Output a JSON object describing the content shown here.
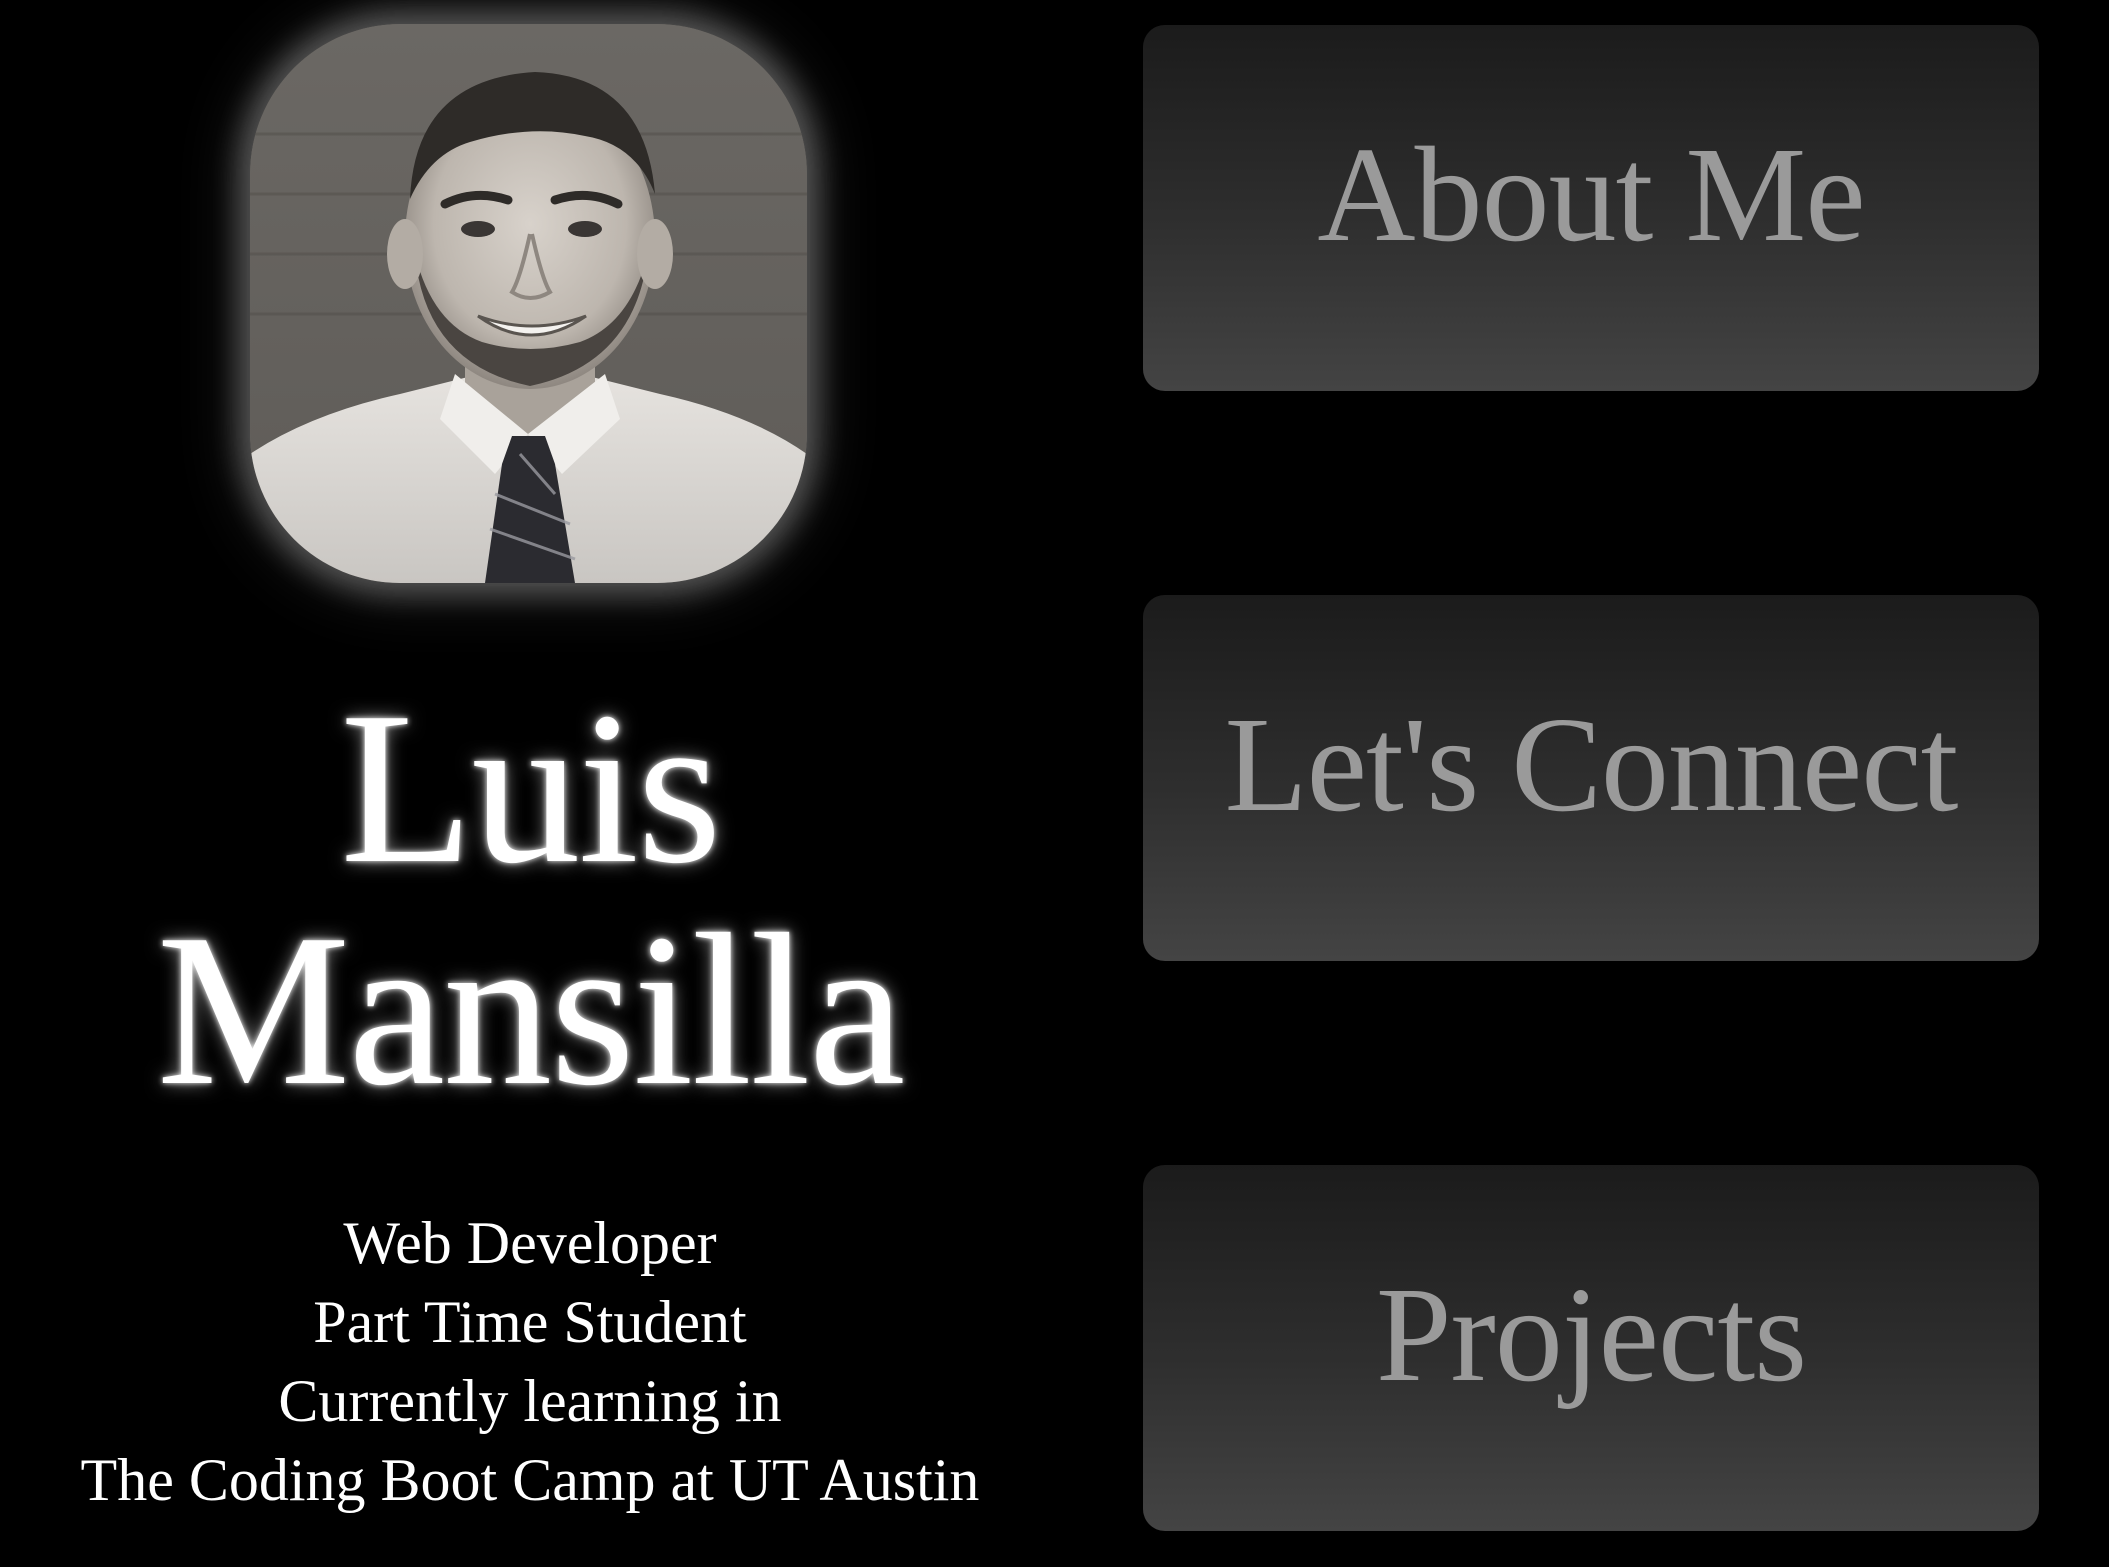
{
  "profile": {
    "first_name": "Luis",
    "last_name": "Mansilla",
    "photo": "portrait photo of Luis Mansilla in shirt and tie",
    "bio_lines": [
      "Web Developer",
      "Part Time Student",
      "Currently learning in",
      "The Coding Boot Camp at UT Austin"
    ]
  },
  "nav": {
    "about_label": "About Me",
    "connect_label": "Let's Connect",
    "projects_label": "Projects"
  },
  "colors": {
    "background": "#000000",
    "button_top": "#1b1b1b",
    "button_bottom": "#444444",
    "button_text": "#9a9a9a",
    "name_text": "#ffffff"
  }
}
